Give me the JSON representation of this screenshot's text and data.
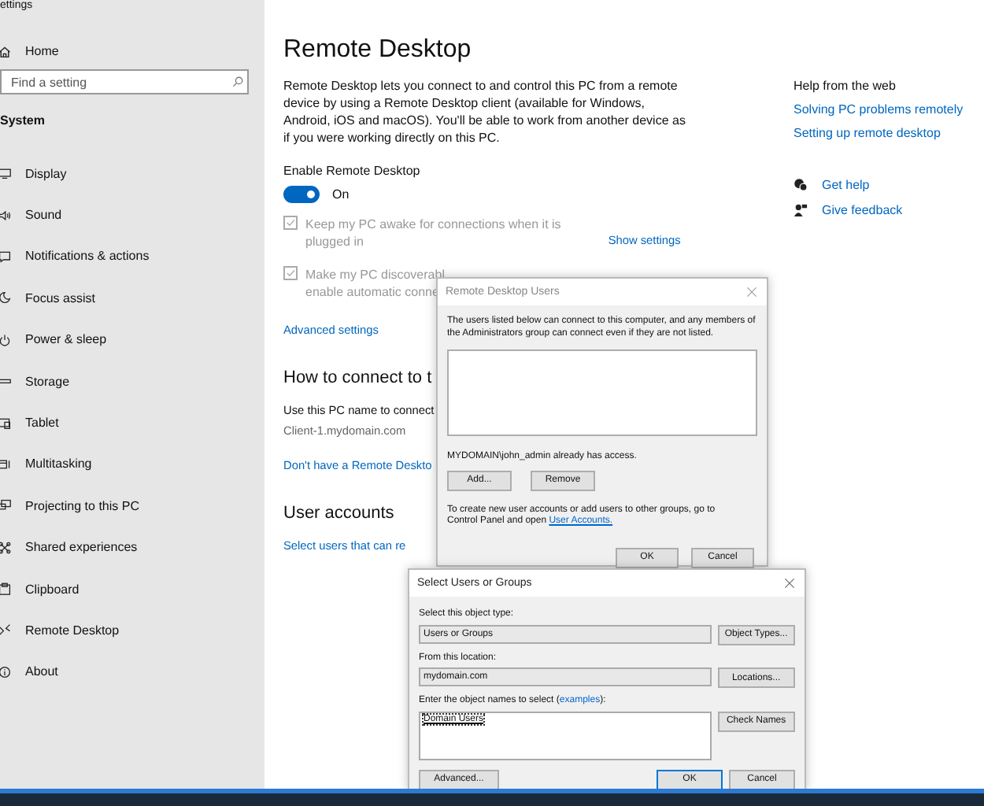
{
  "window": {
    "title": "ettings"
  },
  "sidebar": {
    "home": "Home",
    "search": {
      "placeholder": "Find a setting"
    },
    "section": "System",
    "items": [
      {
        "label": "Display",
        "kind": "display"
      },
      {
        "label": "Sound",
        "kind": "sound"
      },
      {
        "label": "Notifications & actions",
        "kind": "notifications"
      },
      {
        "label": "Focus assist",
        "kind": "moon"
      },
      {
        "label": "Power & sleep",
        "kind": "power"
      },
      {
        "label": "Storage",
        "kind": "storage"
      },
      {
        "label": "Tablet",
        "kind": "tablet"
      },
      {
        "label": "Multitasking",
        "kind": "multitasking"
      },
      {
        "label": "Projecting to this PC",
        "kind": "projecting"
      },
      {
        "label": "Shared experiences",
        "kind": "shared"
      },
      {
        "label": "Clipboard",
        "kind": "clipboard"
      },
      {
        "label": "Remote Desktop",
        "kind": "remote"
      },
      {
        "label": "About",
        "kind": "about"
      }
    ]
  },
  "page": {
    "title": "Remote Desktop",
    "description": "Remote Desktop lets you connect to and control this PC from a remote device by using a Remote Desktop client (available for Windows, Android, iOS and macOS). You'll be able to work from another device as if you were working directly on this PC.",
    "enable_label": "Enable Remote Desktop",
    "toggle": {
      "on": true,
      "label": "On"
    },
    "checkboxes": [
      {
        "lines": [
          "Keep my PC awake for connections when it is",
          "plugged in"
        ],
        "checked": true,
        "disabled": true
      },
      {
        "lines": [
          "Make my PC discoverabl",
          "enable automatic conne"
        ],
        "checked": true,
        "disabled": true
      }
    ],
    "show_settings": "Show settings",
    "advanced": "Advanced settings",
    "connect_heading": "How to connect to t",
    "connect_text": "Use this PC name to connect",
    "pc_name": "Client-1.mydomain.com",
    "client_link": "Don't have a Remote Deskto",
    "accounts_heading": "User accounts",
    "accounts_link": "Select users that can re"
  },
  "help": {
    "heading": "Help from the web",
    "links": [
      "Solving PC problems remotely",
      "Setting up remote desktop"
    ],
    "actions": [
      {
        "label": "Get help",
        "kind": "help"
      },
      {
        "label": "Give feedback",
        "kind": "feedback"
      }
    ]
  },
  "users_dialog": {
    "title": "Remote Desktop Users",
    "intro": "The users listed below can connect to this computer, and any members of the Administrators group can connect even if they are not listed.",
    "access": "MYDOMAIN\\john_admin already has access.",
    "buttons": [
      "Add...",
      "Remove"
    ],
    "note": "To create new user accounts or add users to other groups, go to Control Panel and open ",
    "note_link": "User Accounts.",
    "footer_buttons": [
      {
        "label": "OK",
        "default": false
      },
      {
        "label": "Cancel",
        "default": false
      }
    ]
  },
  "select_dialog": {
    "title": "Select Users or Groups",
    "fields": [
      {
        "label": "Select this object type:",
        "value": "Users or Groups",
        "button": "Object Types..."
      },
      {
        "label": "From this location:",
        "value": "mydomain.com",
        "button": "Locations..."
      }
    ],
    "names_label": "Enter the object names to select (",
    "names_link": "examples",
    "names_label_end": "):",
    "names_value": "Domain Users",
    "check_button": "Check Names",
    "advanced": "Advanced...",
    "footer_buttons": [
      {
        "label": "OK",
        "default": true
      },
      {
        "label": "Cancel",
        "default": false
      }
    ]
  }
}
